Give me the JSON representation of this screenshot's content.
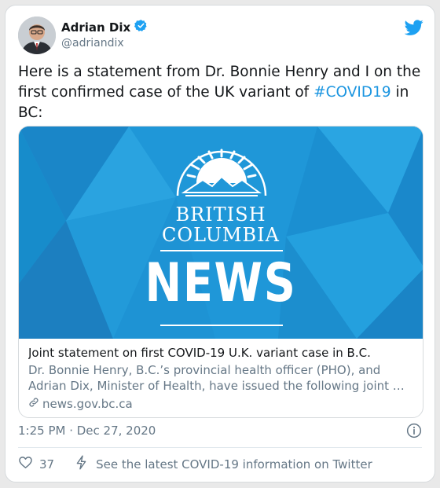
{
  "author": {
    "name": "Adrian Dix",
    "handle": "@adriandix",
    "verified": true
  },
  "tweet": {
    "text_part1": "Here is a statement from Dr. Bonnie Henry and I on the first confirmed case of the UK variant of ",
    "hashtag": "#COVID19",
    "text_part2": " in BC:"
  },
  "card": {
    "image_line1": "BRITISH",
    "image_line2": "COLUMBIA",
    "image_news": "NEWS",
    "title": "Joint statement on first COVID-19 U.K. variant case in B.C.",
    "description": "Dr. Bonnie Henry, B.C.’s provincial health officer (PHO), and Adrian Dix, Minister of Health, have issued the following joint …",
    "domain": "news.gov.bc.ca"
  },
  "timestamp": "1:25 PM · Dec 27, 2020",
  "actions": {
    "like_count": "37",
    "covid_info": "See the latest COVID-19 information on Twitter"
  },
  "colors": {
    "accent": "#1b95e0",
    "muted": "#657786",
    "card_bg": "#1f97d8"
  }
}
